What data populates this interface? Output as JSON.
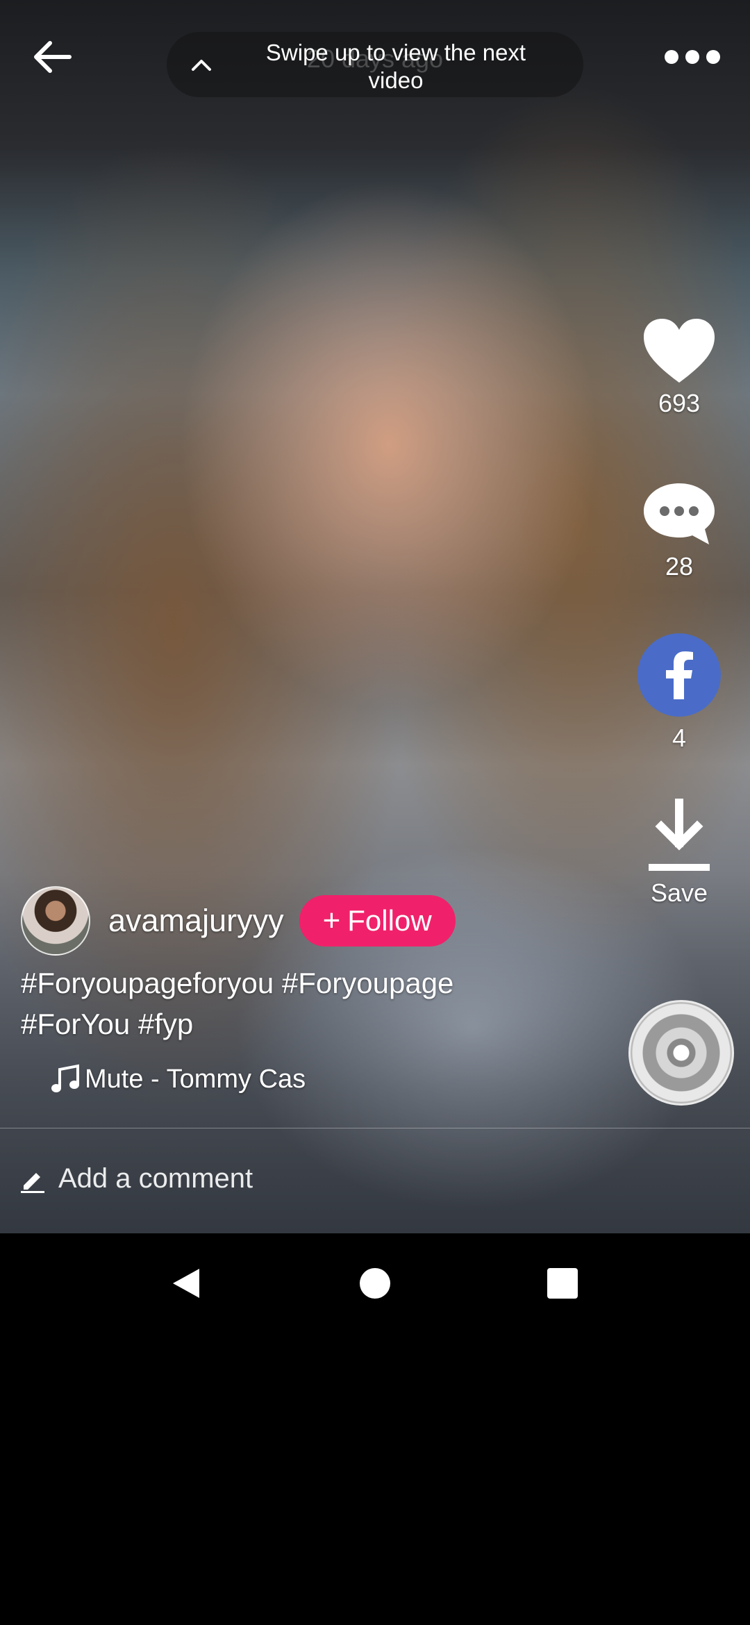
{
  "top": {
    "swipe_hint": "Swipe up to view the next video",
    "posted_ago": "20 days ago"
  },
  "actions": {
    "likes": "693",
    "comments": "28",
    "shares": "4",
    "save_label": "Save"
  },
  "post": {
    "username": "avamajuryyy",
    "follow_label": "Follow",
    "caption": "#Foryoupageforyou #Foryoupage #ForYou #fyp",
    "music": "Mute - Tommy Cas"
  },
  "comment": {
    "placeholder": "Add a comment"
  },
  "colors": {
    "follow": "#f0216a",
    "facebook": "#4a6cc8"
  },
  "icons": [
    "back-arrow-icon",
    "chevron-up-icon",
    "more-icon",
    "heart-icon",
    "comment-icon",
    "facebook-icon",
    "download-icon",
    "music-note-icon",
    "pencil-icon",
    "nav-back-icon",
    "nav-home-icon",
    "nav-recents-icon"
  ]
}
